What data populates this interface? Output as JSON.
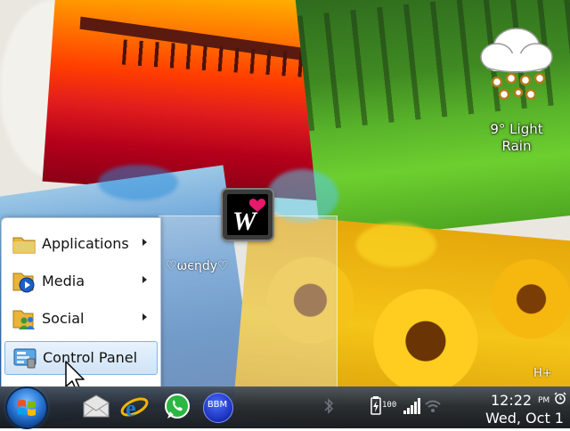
{
  "weather": {
    "icon": "rain-cloud-icon",
    "text": "9° Light Rain"
  },
  "user": {
    "name": "♡ωєηdу♡",
    "avatar_letter": "W"
  },
  "start_menu": {
    "items": [
      {
        "label": "Applications",
        "icon": "folder-icon"
      },
      {
        "label": "Media",
        "icon": "media-folder-icon"
      },
      {
        "label": "Social",
        "icon": "social-folder-icon"
      },
      {
        "label": "Control Panel",
        "icon": "control-panel-icon"
      }
    ]
  },
  "taskbar": {
    "apps": [
      {
        "name": "mail",
        "icon": "mail-icon"
      },
      {
        "name": "internet-explorer",
        "icon": "internet-explorer-icon"
      },
      {
        "name": "whatsapp",
        "icon": "whatsapp-icon"
      },
      {
        "name": "bbm",
        "label": "BBM"
      }
    ]
  },
  "status": {
    "battery": "100",
    "network": "H+",
    "time": "12:22",
    "ampm": "PM",
    "date": "Wed, Oct 1"
  },
  "colors": {
    "accent": "#2a78d6",
    "menu_highlight": "#cfe3f7",
    "taskbar": "#262c34"
  }
}
